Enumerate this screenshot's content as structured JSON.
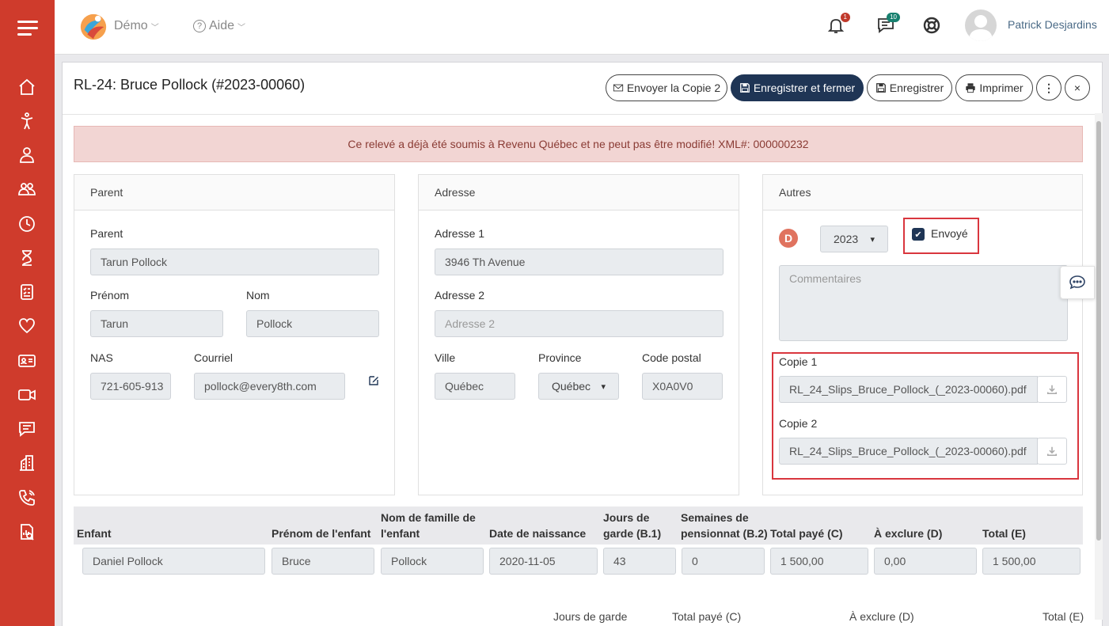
{
  "app": {
    "org_menu": "Démo",
    "help_menu": "Aide",
    "user_name": "Patrick Desjardins",
    "notifications_count": "1",
    "messages_count": "10"
  },
  "sidebar": {
    "icons": [
      "home-icon",
      "child-icon",
      "staff-icon",
      "group-icon",
      "clock-icon",
      "hourglass-icon",
      "checklist-icon",
      "heart-icon",
      "id-card-icon",
      "video-icon",
      "chat-icon",
      "building-icon",
      "phone-icon",
      "report-icon"
    ]
  },
  "record": {
    "title": "RL-24: Bruce Pollock (#2023-00060)",
    "btn_send_copy2": "Envoyer la Copie 2",
    "btn_save_close": "Enregistrer et fermer",
    "btn_save": "Enregistrer",
    "btn_print": "Imprimer",
    "more": "⋮",
    "close": "×",
    "alert": "Ce relevé a déjà été soumis à Revenu Québec et ne peut pas être modifié!  XML#: 000000232"
  },
  "parent_panel": {
    "heading": "Parent",
    "parent_label": "Parent",
    "parent_value": "Tarun Pollock",
    "firstname_label": "Prénom",
    "firstname_value": "Tarun",
    "lastname_label": "Nom",
    "lastname_value": "Pollock",
    "nas_label": "NAS",
    "nas_value": "721-605-913",
    "email_label": "Courriel",
    "email_value": "pollock@every8th.com"
  },
  "address_panel": {
    "heading": "Adresse",
    "addr1_label": "Adresse 1",
    "addr1_value": "3946  Th Avenue",
    "addr2_label": "Adresse 2",
    "addr2_placeholder": "Adresse 2",
    "city_label": "Ville",
    "city_value": "Québec",
    "province_label": "Province",
    "province_value": "Québec",
    "postal_label": "Code postal",
    "postal_value": "X0A0V0"
  },
  "other_panel": {
    "heading": "Autres",
    "d_badge": "D",
    "year_value": "2023",
    "sent_label": "Envoyé",
    "sent_checked": true,
    "comments_placeholder": "Commentaires",
    "copy1_label": "Copie 1",
    "copy1_file": "RL_24_Slips_Bruce_Pollock_(_2023-00060).pdf",
    "copy2_label": "Copie 2",
    "copy2_file": "RL_24_Slips_Bruce_Pollock_(_2023-00060).pdf"
  },
  "child_table": {
    "headers": {
      "child": "Enfant",
      "firstname": "Prénom de l'enfant",
      "lastname": "Nom de famille de l'enfant",
      "dob": "Date de naissance",
      "days": "Jours de garde (B.1)",
      "weeks": "Semaines de pensionnat (B.2)",
      "paid": "Total payé (C)",
      "exclude": "À exclure (D)",
      "total": "Total (E)"
    },
    "row": {
      "child": "Daniel Pollock",
      "firstname": "Bruce",
      "lastname": "Pollock",
      "dob": "2020-11-05",
      "days": "43",
      "weeks": "0",
      "paid": "1 500,00",
      "exclude": "0,00",
      "total": "1 500,00"
    },
    "summary_headers": {
      "days": "Jours de garde",
      "paid": "Total payé (C)",
      "exclude": "À exclure (D)",
      "total": "Total (E)"
    }
  }
}
